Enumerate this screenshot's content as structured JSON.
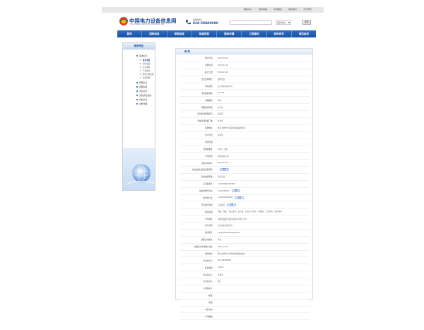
{
  "top_links": [
    "网站中心",
    "我的收藏",
    "在线报名",
    "联系我们",
    "关于我们"
  ],
  "logo": {
    "cn": "中国电力设备信息网",
    "en": "China Power Equipment Information Net"
  },
  "hotline": {
    "label": "客服热线",
    "number": "010-58889990"
  },
  "search": {
    "placeholder": "",
    "select_value": "招标信息",
    "button": "搜索"
  },
  "nav": [
    "首页",
    "招标信息",
    "采购信息",
    "拟建项目",
    "招标代理",
    "工程建设",
    "商务供求",
    "商机会员"
  ],
  "sidebar": {
    "title": "网员专区",
    "items": [
      {
        "label": "基本信息",
        "subs": [
          "基本资料",
          "密码设置",
          "企业资料",
          "产品发布",
          "服务分类管理",
          "商机管理"
        ]
      },
      {
        "label": "调研信息",
        "subs": []
      },
      {
        "label": "调研反馈",
        "subs": []
      },
      {
        "label": "交易记录",
        "subs": []
      },
      {
        "label": "交易买卖/报价",
        "subs": []
      },
      {
        "label": "商务信息",
        "subs": []
      },
      {
        "label": "业务管理",
        "subs": []
      }
    ],
    "active_sub": "基本资料"
  },
  "main": {
    "title": "资 料",
    "rows": [
      {
        "k": "登记时间：",
        "v": "2013-01-01"
      },
      {
        "k": "注册时间：",
        "v": "2013-01-01"
      },
      {
        "k": "截止日期：",
        "v": "2014-01-01"
      },
      {
        "k": "会员注册类型：",
        "v": "银牌会员"
      },
      {
        "k": "单位名称：",
        "v": "北京电力有限公司"
      },
      {
        "k": "单位联系电话：",
        "v": "010-88"
      },
      {
        "k": "注册编码：",
        "v": "华北"
      },
      {
        "k": "所属所在区域：",
        "v": "北京市"
      },
      {
        "k": "所在区域所属部门：",
        "v": "海淀区"
      },
      {
        "k": "所在区域所属门类：",
        "v": "华北区"
      },
      {
        "k": "注册地址：",
        "v": "浙江省金华市东阳市湖溪镇新建村"
      },
      {
        "k": "法人代表：",
        "v": "赵先生"
      },
      {
        "k": "经营范围：",
        "v": ""
      },
      {
        "k": "注册资本金：",
        "v": "100万 元整"
      },
      {
        "k": "公司性质：",
        "v": "有限责任公司"
      },
      {
        "k": "成立年限(年)：",
        "v": "2012-01-01"
      },
      {
        "k": "营业执照扫描件是否附件：",
        "v": "",
        "badge": "查看"
      },
      {
        "k": "营业执照所属：",
        "v": "海淀分局"
      },
      {
        "k": "工商备案号：",
        "v": "110108000000000"
      },
      {
        "k": "组织机构代码证：",
        "v": "1101080001",
        "badge": "查看"
      },
      {
        "k": "税务登记证：",
        "v": "1101080000000",
        "badge": "查看"
      },
      {
        "k": "开户银行名称：",
        "v": "工商银行",
        "badge": "查看"
      },
      {
        "k": "经营范围：",
        "v": "电线、电缆、电工器材、变压器、高低压开关柜、配电箱、五金交电、建筑材料",
        "wrap": true
      },
      {
        "k": "开户银行：",
        "v": "中国建设银行股份有限公司北京分行"
      },
      {
        "k": "开户名称：",
        "v": "北京电力有限公司"
      },
      {
        "k": "银行账号：",
        "v": "1100100000000000000"
      },
      {
        "k": "资质证书编号：",
        "v": "华北"
      },
      {
        "k": "资质证书有效期(日期)：",
        "v": "2015-12-31"
      },
      {
        "k": "通讯地址：",
        "v": "浙江省金华市东阳市湖溪镇新建村"
      },
      {
        "k": "企业负责人：",
        "v": "010-88888888"
      },
      {
        "k": "联系电话：",
        "v": "13800"
      },
      {
        "k": "企业负责人：",
        "v": "李先生"
      },
      {
        "k": "企业负责人：",
        "v": "职工"
      },
      {
        "k": "公司联系人：",
        "v": ""
      },
      {
        "k": "职位：",
        "v": ""
      },
      {
        "k": "电话：",
        "v": ""
      },
      {
        "k": "手机号码：",
        "v": ""
      },
      {
        "k": "公司邮箱：",
        "v": ""
      }
    ]
  }
}
